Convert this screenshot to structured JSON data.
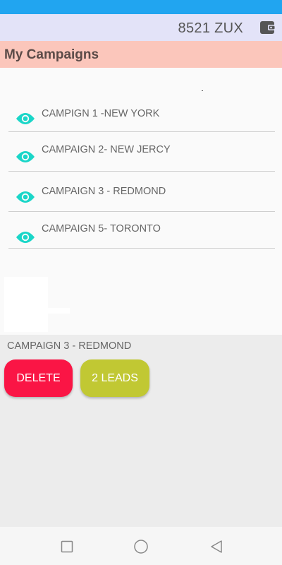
{
  "header": {
    "balance": "8521 ZUX",
    "wallet_icon": "wallet-icon"
  },
  "title": "My Campaigns",
  "campaigns": [
    {
      "label": "CAMPIGN 1 -NEW YORK",
      "icon": "eye-icon"
    },
    {
      "label": "CAMPAIGN 2- NEW JERCY",
      "icon": "eye-icon"
    },
    {
      "label": "CAMPAIGN 3 - REDMOND",
      "icon": "eye-icon"
    },
    {
      "label": "CAMPAIGN 5- TORONTO",
      "icon": "eye-icon"
    }
  ],
  "selection": {
    "label": "CAMPAIGN 3 - REDMOND",
    "delete_label": "DELETE",
    "leads_label": "2 LEADS"
  },
  "colors": {
    "status_bar": "#21a5f0",
    "top_bar": "#e3e3f8",
    "title_bar": "#fbc6bb",
    "eye_icon": "#1ad6c8",
    "delete_button": "#fa1545",
    "leads_button": "#c1c833"
  },
  "nav": {
    "recent_icon": "square-icon",
    "home_icon": "circle-icon",
    "back_icon": "triangle-back-icon"
  }
}
